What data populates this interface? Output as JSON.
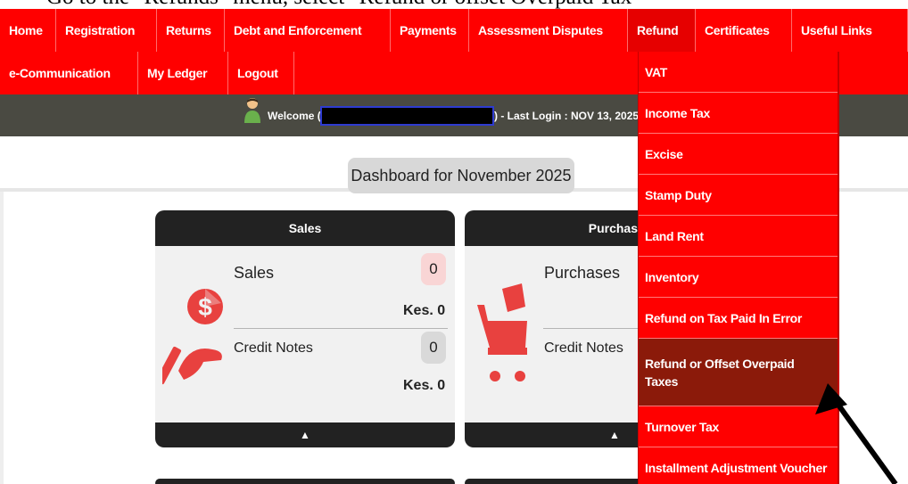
{
  "caption": {
    "text": "Go to the \"Refunds\" menu, select \"Refund or offset Overpaid Tax\""
  },
  "nav": {
    "row1": [
      "Home",
      "Registration",
      "Returns",
      "Debt and Enforcement",
      "Payments",
      "Assessment Disputes",
      "Refund",
      "Certificates",
      "Useful Links"
    ],
    "row2": [
      "e-Communication",
      "My Ledger",
      "Logout"
    ],
    "active": "Refund"
  },
  "user_bar": {
    "welcome": "Welcome (",
    "last_login": ") - Last Login : NOV 13, 2025"
  },
  "dashboard": {
    "title": "Dashboard for November 2025"
  },
  "cards": {
    "sales": {
      "header": "Sales",
      "label1": "Sales",
      "count1": "0",
      "amount1": "Kes. 0",
      "label2": "Credit Notes",
      "count2": "0",
      "amount2": "Kes. 0",
      "footer": "▲"
    },
    "purchases": {
      "header": "Purchas",
      "label1": "Purchases",
      "label2": "Credit Notes",
      "footer": "▲"
    }
  },
  "refund_menu": {
    "items": [
      "VAT",
      "Income Tax",
      "Excise",
      "Stamp Duty",
      "Land Rent",
      "Inventory",
      "Refund on Tax Paid In Error",
      "Refund or Offset Overpaid Taxes",
      "Turnover Tax",
      "Installment Adjustment Voucher"
    ],
    "highlighted": "Refund or Offset Overpaid Taxes"
  },
  "colors": {
    "nav_red": "#ff0000",
    "highlight": "#8b1a0a",
    "user_bar": "#4a4a42",
    "card_header": "#222222",
    "sales_badge": "#f9d5d5",
    "notes_badge": "#d9d9d9",
    "icon_red": "#e8413f"
  }
}
